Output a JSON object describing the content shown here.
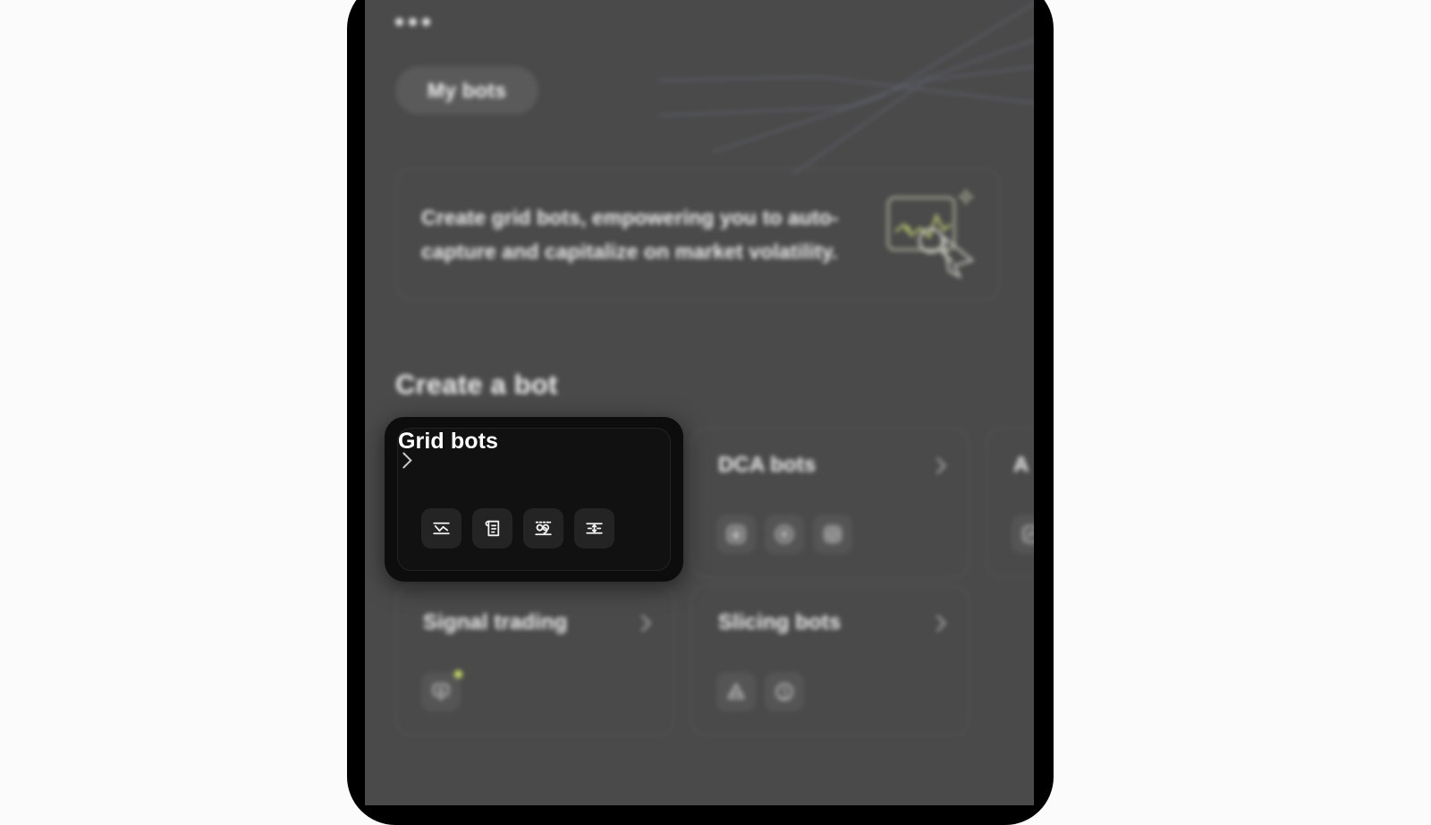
{
  "app": {
    "overflow_menu": "ellipsis-menu",
    "accent_green": "#c9e265",
    "screen_bg": "#4a4a4a",
    "focus_bg": "#0d0d0d"
  },
  "header": {
    "my_bots_label": "My bots"
  },
  "banner": {
    "text": "Create grid bots, empowering you to auto-capture and capitalize on market volatility.",
    "illustration": "chart-magnifier-illustration"
  },
  "section": {
    "title": "Create a bot"
  },
  "cards": [
    {
      "id": "grid-bots",
      "title": "Grid bots",
      "focused": true,
      "chevron": "chevron-right-icon",
      "icons": [
        "spot-grid-icon",
        "futures-grid-icon",
        "infinity-grid-icon",
        "moving-grid-icon"
      ],
      "badges": []
    },
    {
      "id": "dca-bots",
      "title": "DCA bots",
      "focused": false,
      "chevron": "chevron-right-icon",
      "icons": [
        "spot-dca-icon",
        "futures-dca-icon",
        "smart-dca-icon"
      ],
      "badges": []
    },
    {
      "id": "algo-bots",
      "title": "A",
      "focused": false,
      "chevron": "chevron-right-icon",
      "icons": [
        "algo-icon"
      ],
      "badges": []
    },
    {
      "id": "signal-trading",
      "title": "Signal trading",
      "focused": false,
      "chevron": "chevron-right-icon",
      "icons": [
        "signal-bot-icon"
      ],
      "badges": [
        "new-dot"
      ]
    },
    {
      "id": "slicing-bots",
      "title": "Slicing bots",
      "focused": false,
      "chevron": "chevron-right-icon",
      "icons": [
        "twap-icon",
        "iceberg-icon"
      ],
      "badges": []
    }
  ]
}
